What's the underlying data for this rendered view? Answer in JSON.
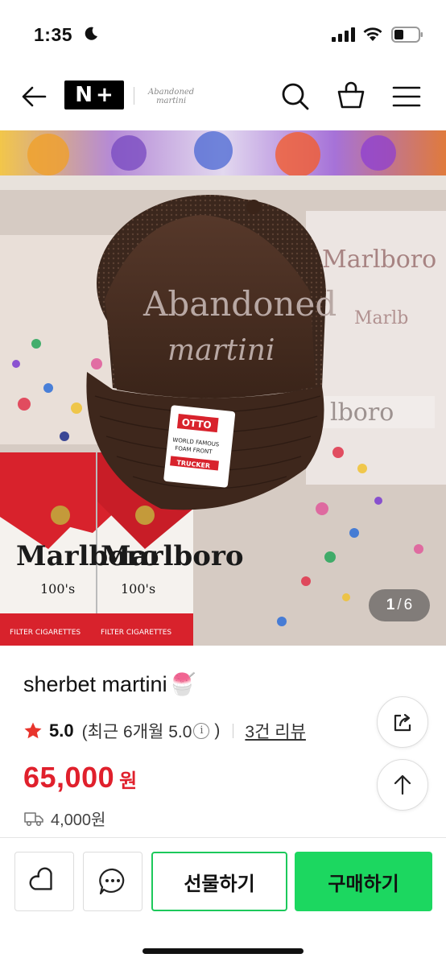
{
  "status_bar": {
    "time": "1:35"
  },
  "header": {
    "logo_n": "N",
    "logo_plus": "+",
    "brand_line1": "Abandoned",
    "brand_line2": "martini"
  },
  "gallery": {
    "current": "1",
    "separator": "/",
    "total": "6",
    "hat_text_line1": "Abandoned",
    "hat_text_line2": "martini",
    "tag_brand": "OTTO",
    "tag_line1": "WORLD FAMOUS",
    "tag_line2": "FOAM FRONT",
    "tag_style": "TRUCKER",
    "box_brand": "Marlboro",
    "box_count": "100's",
    "box_strip": "FILTER CIGARETTES"
  },
  "product": {
    "title": "sherbet martini",
    "title_emoji": "🍧",
    "rating": "5.0",
    "recent_rating": "(최근 6개월 5.0",
    "recent_close": ")",
    "info_glyph": "i",
    "review_link": "3건 리뷰",
    "price": "65,000",
    "price_unit": "원",
    "shipping_fee": "4,000원"
  },
  "actions": {
    "gift_label": "선물하기",
    "buy_label": "구매하기"
  },
  "colors": {
    "price_red": "#e0202c",
    "buy_green": "#1cd760",
    "star": "#e8342c"
  }
}
